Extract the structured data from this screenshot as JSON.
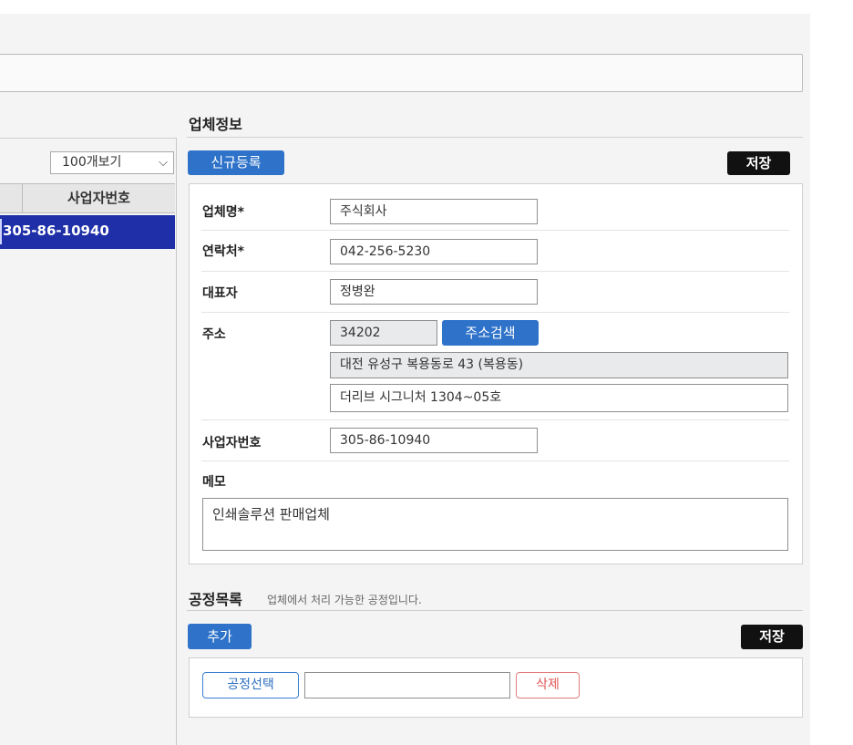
{
  "list": {
    "page_size_select": "100개보기",
    "column_header": "사업자번호",
    "rows": [
      {
        "business_number": "305-86-10940"
      }
    ]
  },
  "company_info": {
    "section_title": "업체정보",
    "new_button": "신규등록",
    "save_button": "저장",
    "fields": {
      "name_label": "업체명*",
      "name_value": "주식회사",
      "contact_label": "연락처*",
      "contact_value": "042-256-5230",
      "ceo_label": "대표자",
      "ceo_value": "정병완",
      "address_label": "주소",
      "zip_value": "34202",
      "address_search_button": "주소검색",
      "address_value": "대전 유성구 복용동로 43 (복용동)",
      "address_detail_value": "더리브 시그니처 1304~05호",
      "business_number_label": "사업자번호",
      "business_number_value": "305-86-10940",
      "memo_label": "메모",
      "memo_value": "인쇄솔루션 판매업체"
    }
  },
  "process_list": {
    "section_title": "공정목록",
    "description": "업체에서 처리 가능한 공정입니다.",
    "add_button": "추가",
    "save_button": "저장",
    "process_select_button": "공정선택",
    "process_input_value": "",
    "delete_button": "삭제"
  },
  "colors": {
    "accent_blue": "#2e72c9",
    "selected_row": "#1e2fa8",
    "save_black": "#111111",
    "delete_red": "#e05555"
  }
}
